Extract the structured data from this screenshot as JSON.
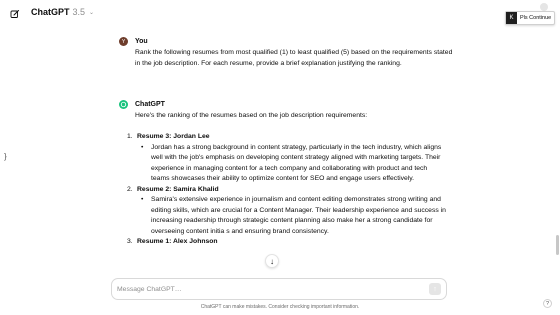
{
  "header": {
    "model_name": "ChatGPT",
    "model_version": "3.5",
    "model_chevron": "⌄"
  },
  "tooltip": {
    "key": "K",
    "text": "Pls Continue"
  },
  "left_stroke": "}",
  "conversation": {
    "user_message": {
      "sender": "You",
      "avatar": "Y",
      "text": "Rank the following resumes from most qualified (1) to least qualified (5) based on the requirements stated in the job description. For each resume, provide a brief explanation justifying the ranking."
    },
    "assistant_message": {
      "sender": "ChatGPT",
      "intro": "Here's the ranking of the resumes based on the job description requirements:",
      "items": [
        {
          "number": "1.",
          "heading": "Resume 3: Jordan Lee",
          "bullet": "Jordan has a strong background in content strategy, particularly in the tech industry, which aligns well with the job's emphasis on developing content strategy aligned with marketing targets. Their experience in managing content for a tech company and collaborating with product and tech teams showcases their ability to optimize content for SEO and engage users effectively."
        },
        {
          "number": "2.",
          "heading": "Resume 2: Samira Khalid",
          "bullet": "Samira's extensive experience in journalism and content editing demonstrates strong writing and editing skills, which are crucial for a Content Manager. Their leadership experience and success in increasing readership through strategic content planning also make her a strong candidate for overseeing content initia   s and ensuring brand consistency."
        },
        {
          "number": "3.",
          "heading": "Resume 1: Alex Johnson",
          "bullet": ""
        }
      ]
    }
  },
  "composer": {
    "placeholder": "Message ChatGPT…",
    "send_icon": "↑",
    "scroll_down_icon": "↓"
  },
  "footer": {
    "note": "ChatGPT can make mistakes. Consider checking important information.",
    "help": "?"
  }
}
